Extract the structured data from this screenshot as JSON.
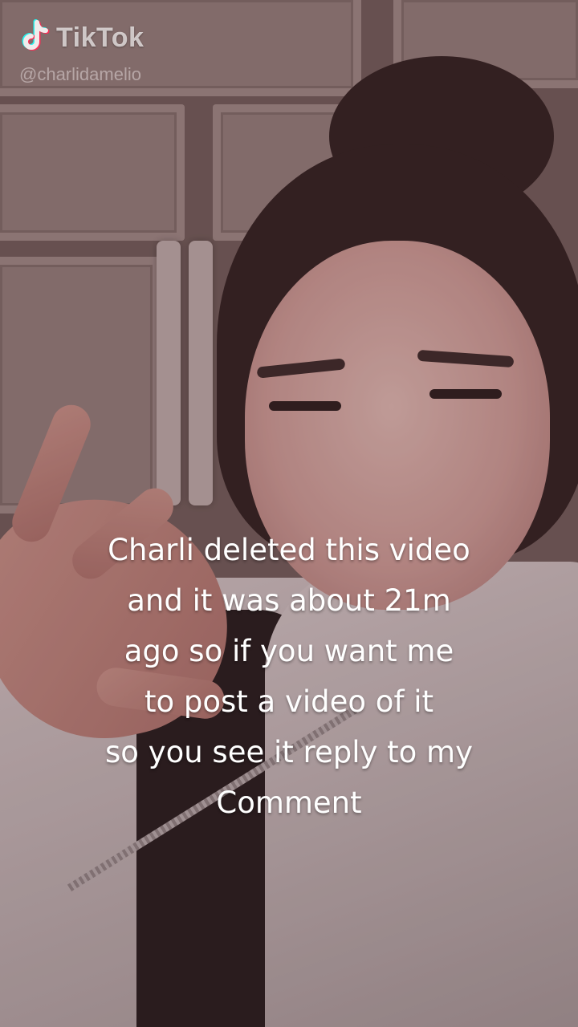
{
  "watermark": {
    "brand": "TikTok",
    "username": "@charlidamelio",
    "logo_icon": "tiktok-note-icon"
  },
  "caption": {
    "lines": [
      "Charli deleted this video",
      "and it was about 21m",
      "ago so if you want me",
      "to post a video of it",
      "so you see it reply to my",
      "Comment"
    ]
  },
  "colors": {
    "caption_text": "#ffffff",
    "watermark_text": "#f0ebeb",
    "logo_cyan": "#25f4ee",
    "logo_red": "#fe2c55"
  }
}
